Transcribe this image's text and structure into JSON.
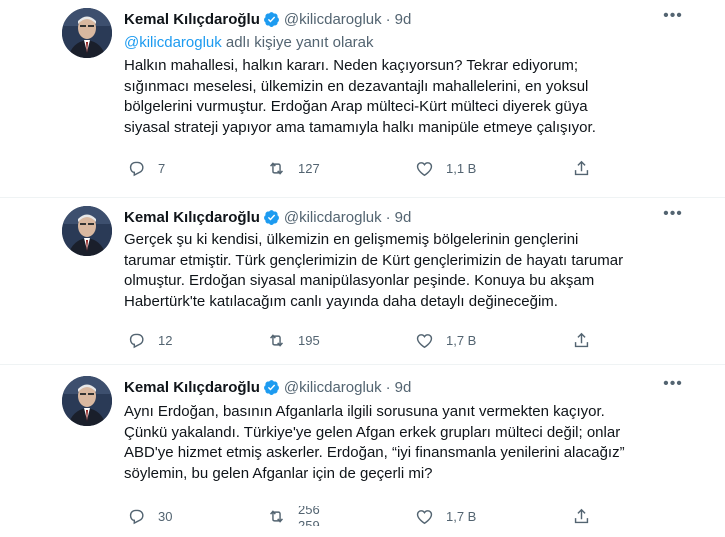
{
  "tweets": [
    {
      "author": "Kemal Kılıçdaroğlu",
      "handle": "@kilicdarogluk",
      "separator": "·",
      "time": "9d",
      "replying": {
        "prefix": "",
        "mention": "@kilicdarogluk",
        "suffix": " adlı kişiye yanıt olarak"
      },
      "lines": [
        "Halkın mahallesi, halkın kararı. Neden kaçıyorsun? Tekrar ediyorum;",
        "sığınmacı meselesi, ülkemizin en dezavantajlı mahallelerini, en yoksul",
        "bölgelerini vurmuştur. Erdoğan Arap mülteci-Kürt mülteci diyerek güya",
        "siyasal strateji yapıyor ama tamamıyla halkı manipüle etmeye çalışıyor."
      ],
      "replies": "7",
      "retweets": "127",
      "likes": "1,1 B"
    },
    {
      "author": "Kemal Kılıçdaroğlu",
      "handle": "@kilicdarogluk",
      "separator": "·",
      "time": "9d",
      "lines": [
        "Gerçek şu ki kendisi, ülkemizin en gelişmemiş bölgelerinin gençlerini",
        "tarumar etmiştir. Türk gençlerimizin de Kürt gençlerimizin de hayatı tarumar",
        "olmuştur. Erdoğan siyasal manipülasyonlar peşinde. Konuya bu akşam",
        "Habertürk'te katılacağım canlı yayında daha detaylı değineceğim."
      ],
      "replies": "12",
      "retweets": "195",
      "likes": "1,7 B"
    },
    {
      "author": "Kemal Kılıçdaroğlu",
      "handle": "@kilicdarogluk",
      "separator": "·",
      "time": "9d",
      "lines": [
        "Aynı Erdoğan, basının Afganlarla ilgili sorusuna yanıt vermekten kaçıyor.",
        "Çünkü yakalandı. Türkiye'ye gelen Afgan erkek grupları mülteci değil; onlar",
        "ABD'ye hizmet etmiş askerler. Erdoğan, “iyi finansmanla yenilerini alacağız”",
        "söylemin, bu gelen Afganlar için de geçerli mi?"
      ],
      "replies": "30",
      "retweets": "256",
      "retweets_next": "259",
      "likes": "1,7 B"
    }
  ],
  "icons": {
    "verified": "verified-badge-icon",
    "more": "more-icon",
    "reply": "reply-icon",
    "retweet": "retweet-icon",
    "like": "heart-icon",
    "share": "share-icon"
  },
  "colors": {
    "text": "#0f1419",
    "secondary": "#536471",
    "accent": "#1d9bf0",
    "divider": "#eff3f4"
  }
}
